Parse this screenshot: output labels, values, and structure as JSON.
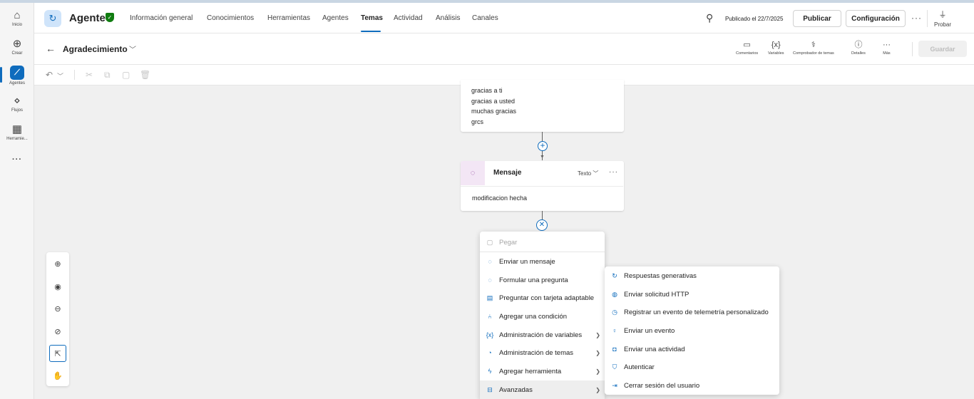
{
  "rail": {
    "items": [
      {
        "label": "Inicio",
        "icon": "home-icon",
        "glyph": "⌂"
      },
      {
        "label": "Crear",
        "icon": "plus-icon",
        "glyph": "⊕"
      },
      {
        "label": "Agentes",
        "icon": "agents-icon",
        "glyph": "⟋"
      },
      {
        "label": "Flujos",
        "icon": "flows-icon",
        "glyph": "⋄"
      },
      {
        "label": "Herramie...",
        "icon": "tools-icon",
        "glyph": "▦"
      },
      {
        "label": "",
        "icon": "more-icon",
        "glyph": "···"
      }
    ]
  },
  "header": {
    "agent_name": "Agente",
    "tabs": [
      "Información general",
      "Conocimientos",
      "Herramientas",
      "Agentes",
      "Temas",
      "Actividad",
      "Análisis",
      "Canales"
    ],
    "selected_tab": "Temas",
    "published": "Publicado el 22/7/2025",
    "publish_label": "Publicar",
    "config_label": "Configuración",
    "test_label": "Probar"
  },
  "subheader": {
    "topic_name": "Agradecimiento",
    "tools": [
      {
        "label": "Comentarios",
        "glyph": "▭"
      },
      {
        "label": "Variables",
        "glyph": "{x}"
      },
      {
        "label": "Comprobador de temas",
        "glyph": "⚕"
      },
      {
        "label": "Detalles",
        "glyph": "ⓘ"
      },
      {
        "label": "Más",
        "glyph": "···"
      }
    ],
    "save_label": "Guardar"
  },
  "canvas": {
    "trigger_phrases": [
      "gracias a ti",
      "gracias a usted",
      "muchas gracias",
      "grcs"
    ],
    "message_node": {
      "title": "Mensaje",
      "type_label": "Texto",
      "text": "modificacion hecha"
    }
  },
  "menu": {
    "items": [
      {
        "label": "Pegar",
        "glyph": "▢",
        "disabled": true
      },
      {
        "label": "Enviar un mensaje",
        "glyph": "◌"
      },
      {
        "label": "Formular una pregunta",
        "glyph": "◌"
      },
      {
        "label": "Preguntar con tarjeta adaptable",
        "glyph": "▤"
      },
      {
        "label": "Agregar una condición",
        "glyph": "⑃"
      },
      {
        "label": "Administración de variables",
        "glyph": "{x}",
        "submenu": true
      },
      {
        "label": "Administración de temas",
        "glyph": "◔",
        "submenu": true
      },
      {
        "label": "Agregar herramienta",
        "glyph": "ϟ",
        "submenu": true
      },
      {
        "label": "Avanzadas",
        "glyph": "⊟",
        "submenu": true,
        "highlighted": true
      }
    ]
  },
  "submenu": {
    "items": [
      {
        "label": "Respuestas generativas",
        "glyph": "↻"
      },
      {
        "label": "Enviar solicitud HTTP",
        "glyph": "◍"
      },
      {
        "label": "Registrar un evento de telemetría personalizado",
        "glyph": "◷"
      },
      {
        "label": "Enviar un evento",
        "glyph": "♀"
      },
      {
        "label": "Enviar una actividad",
        "glyph": "◘"
      },
      {
        "label": "Autenticar",
        "glyph": "⛉"
      },
      {
        "label": "Cerrar sesión del usuario",
        "glyph": "⇥"
      }
    ]
  },
  "colors": {
    "accent": "#0f6cbd",
    "message_icon_bg": "#f3e6f5",
    "canvas_bg": "#f0f0f0"
  }
}
